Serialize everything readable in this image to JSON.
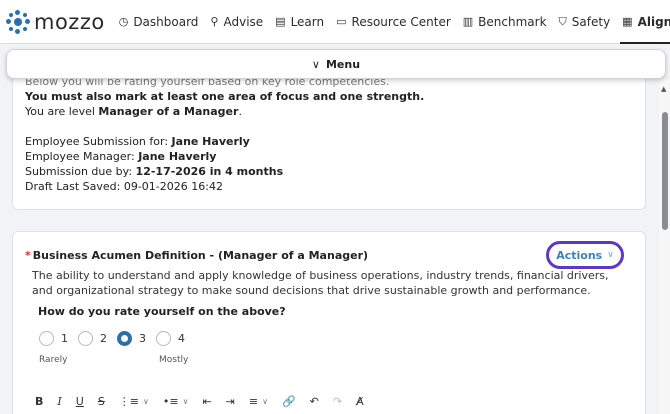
{
  "brand": {
    "name": "mozzo"
  },
  "nav": {
    "items": [
      {
        "label": "Dashboard",
        "icon": "dashboard-icon",
        "glyph": "◷"
      },
      {
        "label": "Advise",
        "icon": "advise-icon",
        "glyph": "⚲"
      },
      {
        "label": "Learn",
        "icon": "learn-icon",
        "glyph": "▤"
      },
      {
        "label": "Resource Center",
        "icon": "resource-center-icon",
        "glyph": "▭"
      },
      {
        "label": "Benchmark",
        "icon": "benchmark-icon",
        "glyph": "▥"
      },
      {
        "label": "Safety",
        "icon": "safety-icon",
        "glyph": "⛉"
      },
      {
        "label": "Align",
        "icon": "align-icon",
        "glyph": "▦",
        "active": true
      }
    ],
    "more": "···"
  },
  "menu": {
    "label": "Menu",
    "chevron": "∨"
  },
  "intro": {
    "clipped_line": "Below you will be rating yourself based on key role competencies.",
    "must_mark": "You must also mark at least one area of focus and one strength.",
    "level_prefix": "You are level ",
    "level_value": "Manager of a Manager",
    "level_suffix": ".",
    "submission_for_label": "Employee Submission for: ",
    "submission_for_value": "Jane Haverly",
    "manager_label": "Employee Manager: ",
    "manager_value": "Jane Haverly",
    "due_label": "Submission due by: ",
    "due_value": "12-17-2026 in 4 months",
    "draft_saved": "Draft Last Saved: 09-01-2026 16:42"
  },
  "question": {
    "required_mark": "*",
    "title": "Business Acumen Definition - (Manager of a Manager)",
    "actions_label": "Actions",
    "actions_chevron": "∨",
    "description": "The ability to understand and apply knowledge of business operations, industry trends, financial drivers, and organizational strategy to make sound decisions that drive sustainable growth and performance.",
    "prompt": "How do you rate yourself on the above?",
    "options": [
      "1",
      "2",
      "3",
      "4"
    ],
    "selected": "3",
    "scale_low": "Rarely",
    "scale_high": "Mostly"
  },
  "editor_toolbar": {
    "bold": "B",
    "italic": "I",
    "underline": "U",
    "strike": "S",
    "numbered_list": "⋮≡",
    "bullet_list": "•≡",
    "dropdown": "∨",
    "outdent": "⇤",
    "indent": "⇥",
    "align": "≡",
    "link": "🔗",
    "undo": "↶",
    "redo": "↷",
    "clear_format": "A̸"
  },
  "colors": {
    "accent": "#2d6fa6",
    "actions_border": "#5b38c8",
    "required": "#d0312d"
  }
}
